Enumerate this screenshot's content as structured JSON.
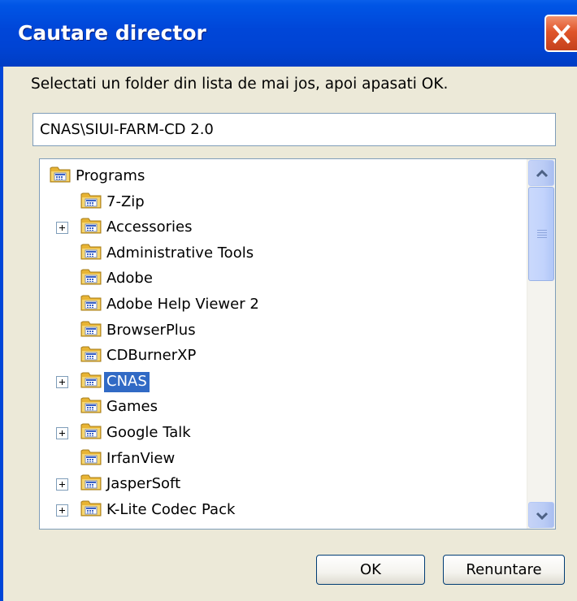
{
  "window": {
    "title": "Cautare director"
  },
  "prompt": "Selectati un folder din lista de mai jos, apoi apasati OK.",
  "path_field": {
    "value": "CNAS\\SIUI-FARM-CD 2.0"
  },
  "tree": {
    "items": [
      {
        "label": "Programs",
        "level": 0,
        "expandable": false,
        "selected": false
      },
      {
        "label": "7-Zip",
        "level": 1,
        "expandable": false,
        "selected": false
      },
      {
        "label": "Accessories",
        "level": 1,
        "expandable": true,
        "selected": false
      },
      {
        "label": "Administrative Tools",
        "level": 1,
        "expandable": false,
        "selected": false
      },
      {
        "label": "Adobe",
        "level": 1,
        "expandable": false,
        "selected": false
      },
      {
        "label": "Adobe Help Viewer 2",
        "level": 1,
        "expandable": false,
        "selected": false
      },
      {
        "label": "BrowserPlus",
        "level": 1,
        "expandable": false,
        "selected": false
      },
      {
        "label": "CDBurnerXP",
        "level": 1,
        "expandable": false,
        "selected": false
      },
      {
        "label": "CNAS",
        "level": 1,
        "expandable": true,
        "selected": true
      },
      {
        "label": "Games",
        "level": 1,
        "expandable": false,
        "selected": false
      },
      {
        "label": "Google Talk",
        "level": 1,
        "expandable": true,
        "selected": false
      },
      {
        "label": "IrfanView",
        "level": 1,
        "expandable": false,
        "selected": false
      },
      {
        "label": "JasperSoft",
        "level": 1,
        "expandable": true,
        "selected": false
      },
      {
        "label": "K-Lite Codec Pack",
        "level": 1,
        "expandable": true,
        "selected": false
      }
    ]
  },
  "buttons": {
    "ok": "OK",
    "cancel": "Renuntare"
  },
  "colors": {
    "title_bar": "#0046D8",
    "selection": "#316AC5",
    "dialog_bg": "#ECE9D8",
    "close_button": "#E0552A"
  },
  "icons": {
    "folder": "folder-icon",
    "expand": "plus-box-icon",
    "close": "close-x-icon"
  }
}
